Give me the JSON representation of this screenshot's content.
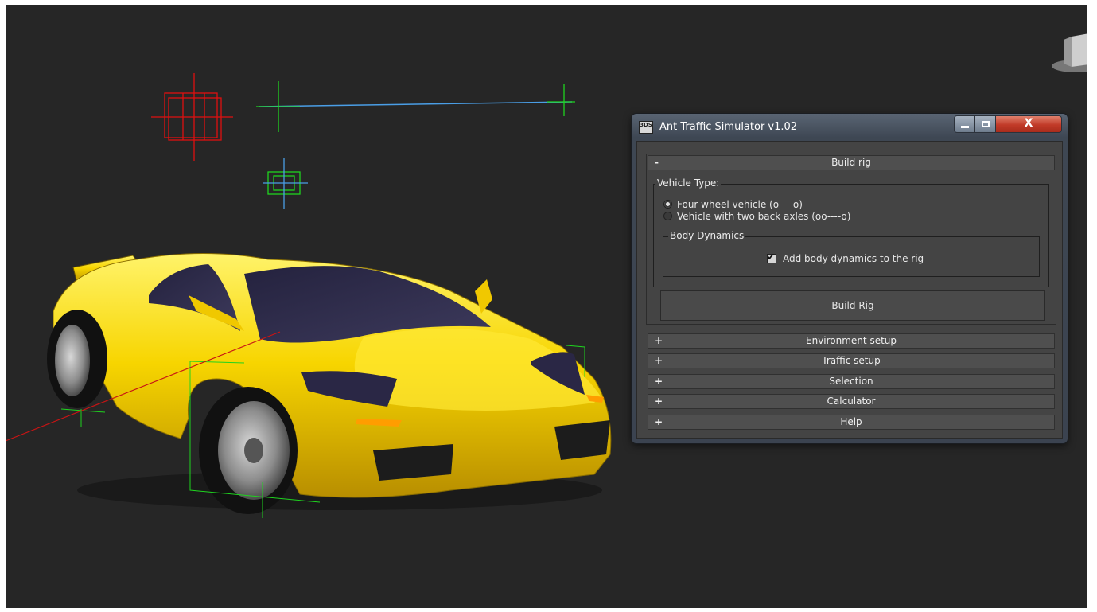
{
  "window": {
    "title": "Ant Traffic Simulator v1.02",
    "icon_text": "3DS",
    "controls": [
      "minimize",
      "maximize",
      "close"
    ]
  },
  "build_rig": {
    "sign": "-",
    "label": "Build rig",
    "vehicle_type": {
      "legend": "Vehicle Type:",
      "options": [
        {
          "label": "Four wheel vehicle (o----o)",
          "selected": true
        },
        {
          "label": "Vehicle with two back axles (oo----o)",
          "selected": false
        }
      ]
    },
    "body_dynamics": {
      "legend": "Body Dynamics",
      "checkbox_label": "Add body dynamics to the rig",
      "checked": true
    },
    "button_label": "Build Rig"
  },
  "collapsed_rollouts": [
    {
      "sign": "+",
      "label": "Environment setup"
    },
    {
      "sign": "+",
      "label": "Traffic setup"
    },
    {
      "sign": "+",
      "label": "Selection"
    },
    {
      "sign": "+",
      "label": "Calculator"
    },
    {
      "sign": "+",
      "label": "Help"
    }
  ],
  "colors": {
    "viewport_bg": "#262626",
    "car_body": "#f5d300",
    "helper_red": "#e01010",
    "helper_green": "#1fd41f",
    "helper_blue": "#4a9ee6"
  }
}
